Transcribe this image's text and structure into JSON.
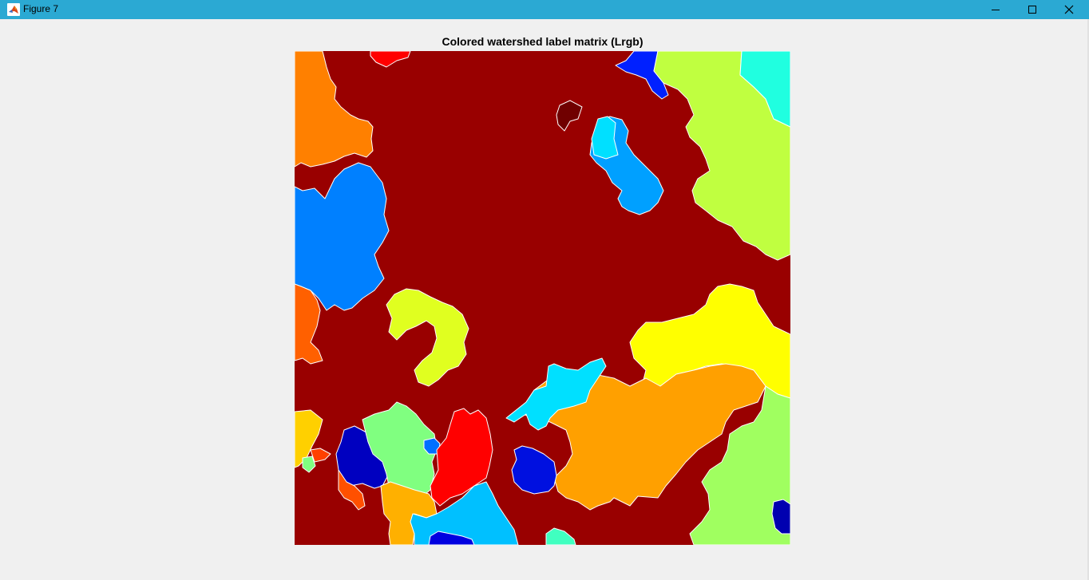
{
  "window": {
    "title": "Figure 7",
    "controls": {
      "minimize_icon": "minimize-icon",
      "maximize_icon": "maximize-icon",
      "close_icon": "close-icon"
    },
    "titlebar_color": "#2ba9d3"
  },
  "figure": {
    "title": "Colored watershed label matrix (Lrgb)",
    "background_label_color": "#990000",
    "image": "watershed-label-image"
  }
}
